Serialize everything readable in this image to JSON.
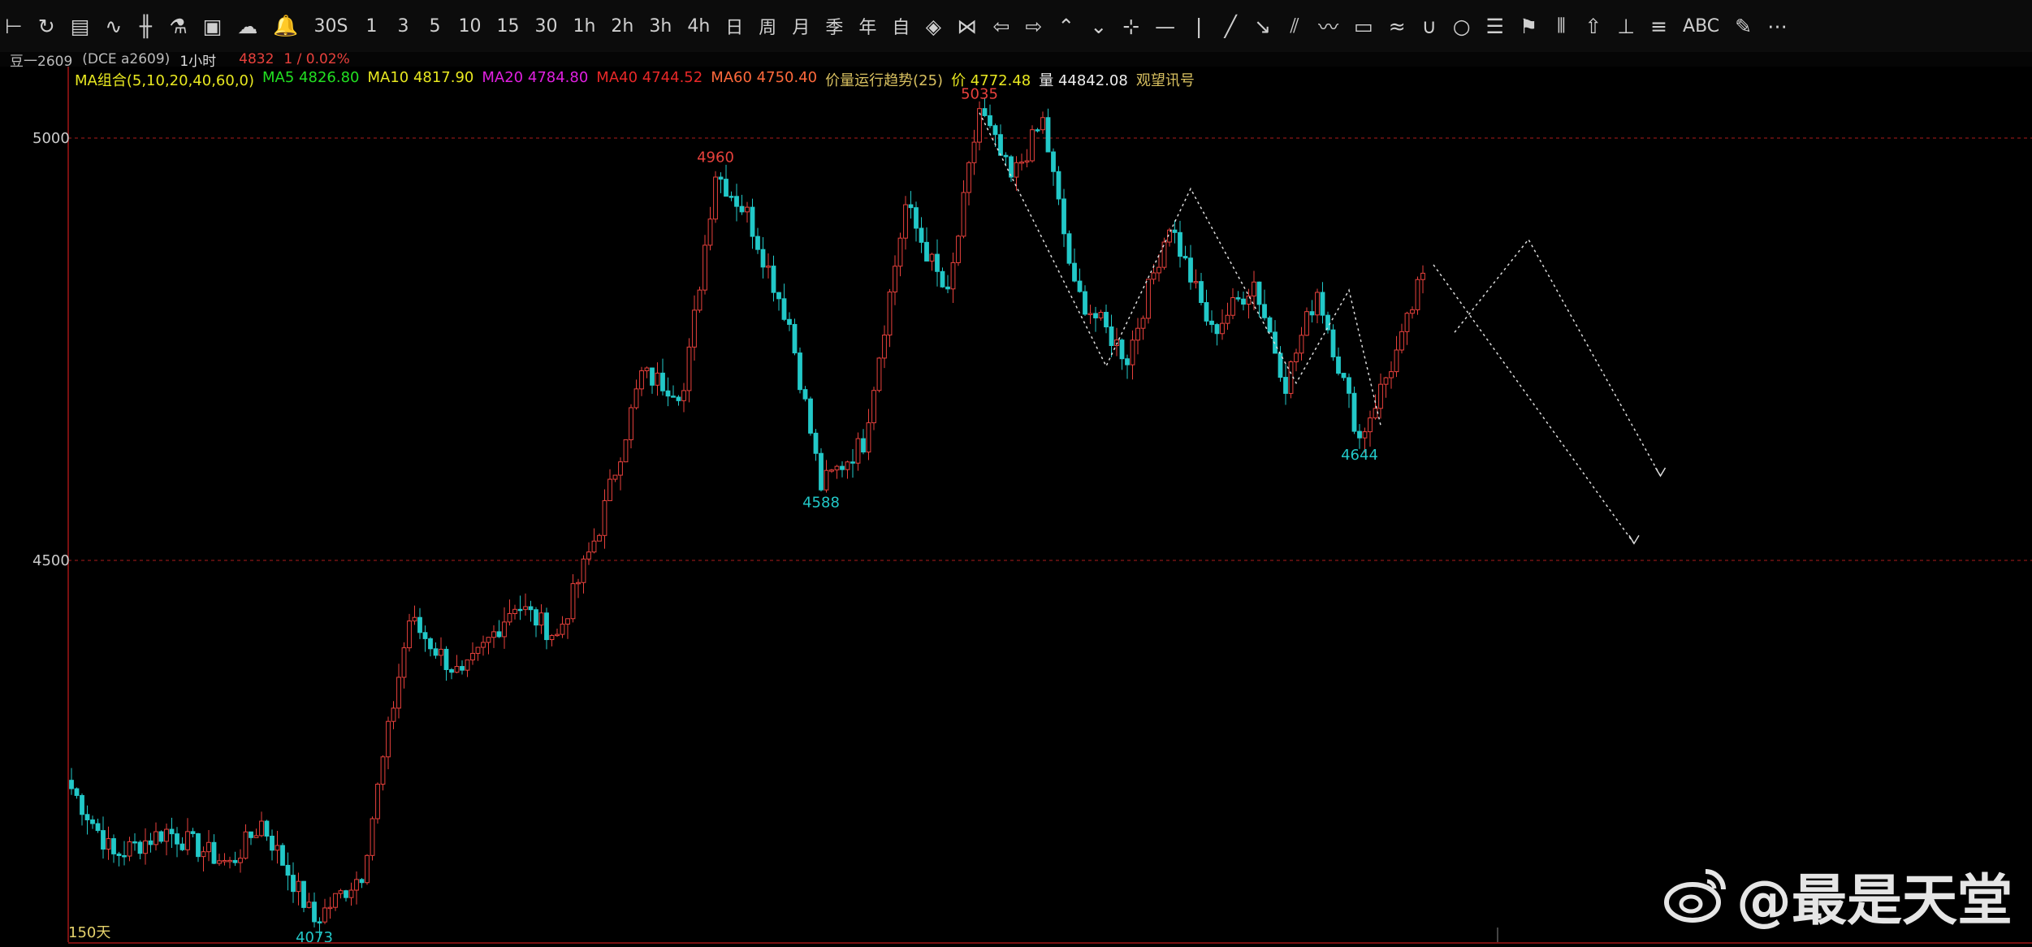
{
  "toolbar": {
    "items": [
      {
        "name": "collapse-icon",
        "glyph": "⊢"
      },
      {
        "name": "refresh-icon",
        "glyph": "↻"
      },
      {
        "name": "table-icon",
        "glyph": "▤"
      },
      {
        "name": "line-chart-icon",
        "glyph": "∿"
      },
      {
        "name": "candlestick-icon",
        "glyph": "╫"
      },
      {
        "name": "indicator-icon",
        "glyph": "⚗"
      },
      {
        "name": "layout-icon",
        "glyph": "▣"
      },
      {
        "name": "cloud-sync-icon",
        "glyph": "☁"
      },
      {
        "name": "alarm-bell-icon",
        "glyph": "🔔"
      },
      {
        "name": "period-30s",
        "label": "30S"
      },
      {
        "name": "period-1",
        "label": "1"
      },
      {
        "name": "period-3",
        "label": "3"
      },
      {
        "name": "period-5",
        "label": "5"
      },
      {
        "name": "period-10",
        "label": "10"
      },
      {
        "name": "period-15",
        "label": "15"
      },
      {
        "name": "period-30",
        "label": "30"
      },
      {
        "name": "period-1h",
        "label": "1h"
      },
      {
        "name": "period-2h",
        "label": "2h"
      },
      {
        "name": "period-3h",
        "label": "3h"
      },
      {
        "name": "period-4h",
        "label": "4h"
      },
      {
        "name": "period-day",
        "label": "日"
      },
      {
        "name": "period-week",
        "label": "周"
      },
      {
        "name": "period-month",
        "label": "月"
      },
      {
        "name": "period-season",
        "label": "季"
      },
      {
        "name": "period-year",
        "label": "年"
      },
      {
        "name": "period-custom",
        "label": "自"
      },
      {
        "name": "compress-icon",
        "glyph": "◈"
      },
      {
        "name": "expand-icon",
        "glyph": "⋈"
      },
      {
        "name": "arrow-left-icon",
        "glyph": "⇦"
      },
      {
        "name": "arrow-right-icon",
        "glyph": "⇨"
      },
      {
        "name": "zoom-in-icon",
        "glyph": "⌃"
      },
      {
        "name": "zoom-out-icon",
        "glyph": "⌄"
      },
      {
        "name": "cursor-icon",
        "glyph": "⊹"
      },
      {
        "name": "hline-icon",
        "glyph": "—"
      },
      {
        "name": "vline-icon",
        "glyph": "|"
      },
      {
        "name": "segment-icon",
        "glyph": "╱"
      },
      {
        "name": "ray-icon",
        "glyph": "↘"
      },
      {
        "name": "channel-icon",
        "glyph": "⫽"
      },
      {
        "name": "wave-icon",
        "glyph": "〰"
      },
      {
        "name": "rectangle-icon",
        "glyph": "▭"
      },
      {
        "name": "zigzag-icon",
        "glyph": "≈"
      },
      {
        "name": "arc-icon",
        "glyph": "∪"
      },
      {
        "name": "circle-icon",
        "glyph": "○"
      },
      {
        "name": "fib-icon",
        "glyph": "☰"
      },
      {
        "name": "flag-icon",
        "glyph": "⚑"
      },
      {
        "name": "bars-icon",
        "glyph": "⦀"
      },
      {
        "name": "up-arrow-icon",
        "glyph": "⇧"
      },
      {
        "name": "measure-icon",
        "glyph": "⊥"
      },
      {
        "name": "text-lines-icon",
        "glyph": "≡"
      },
      {
        "name": "abc-text-icon",
        "label": "ABC"
      },
      {
        "name": "eraser-icon",
        "glyph": "✎"
      },
      {
        "name": "more-icon",
        "glyph": "⋯"
      }
    ]
  },
  "info": {
    "contract": "豆一2609",
    "exchange": "(DCE a2609)",
    "period": "1小时",
    "last_price": "4832",
    "change": "1 / 0.02%"
  },
  "legend": {
    "ma_group": "MA组合(5,10,20,40,60,0)",
    "ma5": "MA5 4826.80",
    "ma10": "MA10 4817.90",
    "ma20": "MA20 4784.80",
    "ma40": "MA40 4744.52",
    "ma60": "MA60 4750.40",
    "trend": "价量运行趋势(25)",
    "price": "价 4772.48",
    "volume": "量 44842.08",
    "signal": "观望讯号"
  },
  "colors": {
    "up": "#e8413c",
    "down": "#22c8c8",
    "ma5": "#22e022",
    "ma10": "#e8e820",
    "ma20": "#e020e0",
    "ma40": "#e82828",
    "ma60": "#ff6a3c",
    "grid": "#8a1616",
    "axis_text": "#cccccc"
  },
  "chart_data": {
    "type": "candlestick",
    "y_axis_labels": [
      "5000",
      "4500"
    ],
    "ylim": [
      4070,
      5045
    ],
    "bars_shown": 150,
    "days_label": "150天",
    "swing_points": [
      {
        "bar": 0,
        "price": 4230
      },
      {
        "bar": 8,
        "price": 4150
      },
      {
        "bar": 18,
        "price": 4180
      },
      {
        "bar": 30,
        "price": 4140
      },
      {
        "bar": 36,
        "price": 4190
      },
      {
        "bar": 46,
        "price": 4073,
        "label": "4073",
        "kind": "low"
      },
      {
        "bar": 55,
        "price": 4130
      },
      {
        "bar": 64,
        "price": 4430
      },
      {
        "bar": 74,
        "price": 4360
      },
      {
        "bar": 84,
        "price": 4450
      },
      {
        "bar": 92,
        "price": 4410
      },
      {
        "bar": 100,
        "price": 4540
      },
      {
        "bar": 108,
        "price": 4720
      },
      {
        "bar": 116,
        "price": 4700
      },
      {
        "bar": 122,
        "price": 4960,
        "label": "4960",
        "kind": "high"
      },
      {
        "bar": 128,
        "price": 4910
      },
      {
        "bar": 136,
        "price": 4780
      },
      {
        "bar": 142,
        "price": 4588,
        "label": "4588",
        "kind": "low"
      },
      {
        "bar": 150,
        "price": 4640
      },
      {
        "bar": 158,
        "price": 4920
      },
      {
        "bar": 166,
        "price": 4810
      },
      {
        "bar": 172,
        "price": 5035,
        "label": "5035",
        "kind": "high"
      },
      {
        "bar": 178,
        "price": 4950
      },
      {
        "bar": 184,
        "price": 5020
      },
      {
        "bar": 190,
        "price": 4820
      },
      {
        "bar": 200,
        "price": 4740
      },
      {
        "bar": 208,
        "price": 4900
      },
      {
        "bar": 216,
        "price": 4770
      },
      {
        "bar": 224,
        "price": 4830
      },
      {
        "bar": 230,
        "price": 4710
      },
      {
        "bar": 236,
        "price": 4820
      },
      {
        "bar": 244,
        "price": 4644,
        "label": "4644",
        "kind": "low"
      },
      {
        "bar": 252,
        "price": 4760
      },
      {
        "bar": 256,
        "price": 4840
      }
    ],
    "drawings": [
      {
        "type": "dotted-polyline",
        "points": [
          [
            172,
            5030
          ],
          [
            196,
            4730
          ],
          [
            212,
            4940
          ],
          [
            232,
            4710
          ],
          [
            242,
            4820
          ],
          [
            248,
            4660
          ]
        ]
      },
      {
        "type": "dotted-projection",
        "points": [
          [
            258,
            4850
          ],
          [
            296,
            4520
          ]
        ]
      },
      {
        "type": "dotted-projection",
        "points": [
          [
            262,
            4770
          ],
          [
            276,
            4880
          ],
          [
            301,
            4600
          ]
        ]
      }
    ]
  },
  "watermark": {
    "text": "@最是天堂"
  }
}
